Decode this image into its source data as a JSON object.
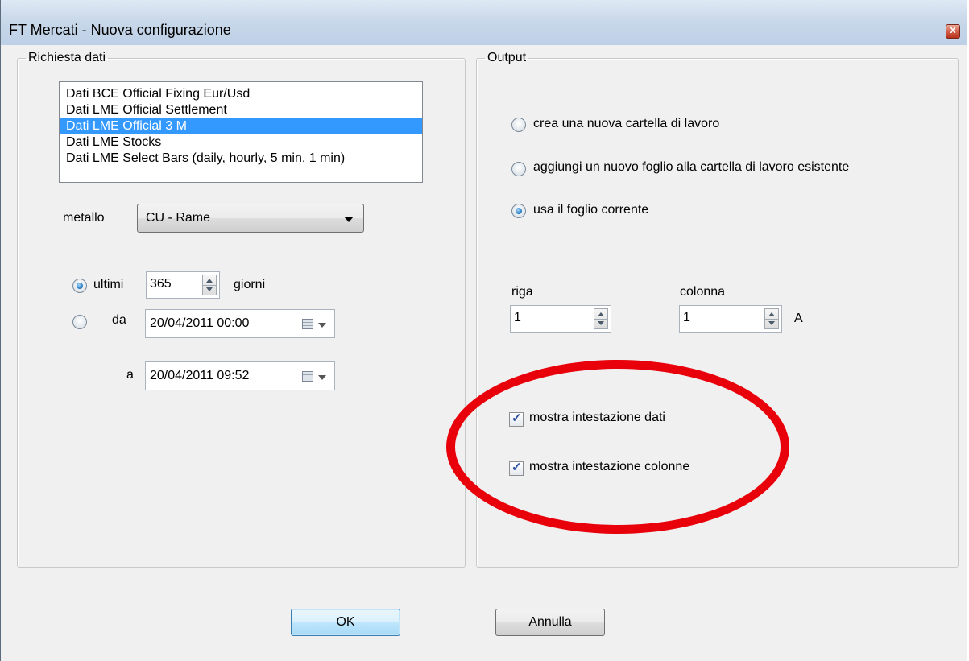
{
  "window": {
    "title": "FT Mercati - Nuova configurazione",
    "close_glyph": "x"
  },
  "request": {
    "legend": "Richiesta dati",
    "list_items": [
      "Dati BCE Official Fixing Eur/Usd",
      "Dati LME Official Settlement",
      "Dati LME Official 3 M",
      "Dati LME Stocks",
      "Dati LME Select Bars (daily, hourly, 5 min, 1 min)"
    ],
    "selected_item": "Dati LME Official 3 M",
    "metal_label": "metallo",
    "metal_value": "CU - Rame",
    "last_label": "ultimi",
    "last_value": "365",
    "days_label": "giorni",
    "from_label": "da",
    "from_value": "20/04/2011 00:00",
    "to_label": "a",
    "to_value": "20/04/2011 09:52",
    "period_mode": "ultimi"
  },
  "output": {
    "legend": "Output",
    "options": [
      "crea una nuova cartella di lavoro",
      "aggiungi un nuovo foglio alla cartella di lavoro esistente",
      "usa il foglio corrente"
    ],
    "selected_option": "usa il foglio corrente",
    "row_label": "riga",
    "row_value": "1",
    "col_label": "colonna",
    "col_value": "1",
    "col_letter": "A",
    "show_data_header": "mostra intestazione dati",
    "show_data_header_checked": true,
    "show_col_header": "mostra intestazione colonne",
    "show_col_header_checked": true
  },
  "buttons": {
    "ok": "OK",
    "cancel": "Annulla"
  },
  "annotation": {
    "color": "#e8000b"
  }
}
